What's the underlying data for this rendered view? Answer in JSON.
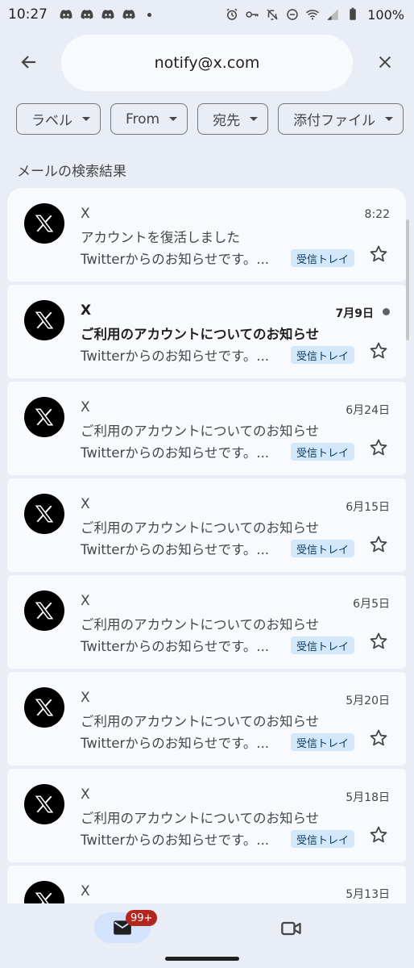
{
  "status_bar": {
    "time": "10:27",
    "battery": "100%",
    "left_icons": [
      "discord-icon",
      "discord-icon",
      "discord-icon",
      "discord-icon"
    ],
    "right_icons": [
      "alarm-icon",
      "key-icon",
      "bell-off-icon",
      "do-not-disturb-icon",
      "wifi-icon",
      "signal-icon",
      "battery-icon"
    ]
  },
  "search": {
    "query": "notify@x.com"
  },
  "filters": [
    {
      "label": "ラベル"
    },
    {
      "label": "From"
    },
    {
      "label": "宛先"
    },
    {
      "label": "添付ファイル"
    }
  ],
  "section_title": "メールの検索結果",
  "emails": [
    {
      "sender": "X",
      "date": "8:22",
      "subject": "アカウントを復活しました",
      "snippet": "Twitterからのお知らせです。...",
      "label": "受信トレイ",
      "unread": false
    },
    {
      "sender": "X",
      "date": "7月9日",
      "subject": "ご利用のアカウントについてのお知らせ",
      "snippet": "Twitterからのお知らせです。...",
      "label": "受信トレイ",
      "unread": true
    },
    {
      "sender": "X",
      "date": "6月24日",
      "subject": "ご利用のアカウントについてのお知らせ",
      "snippet": "Twitterからのお知らせです。...",
      "label": "受信トレイ",
      "unread": false
    },
    {
      "sender": "X",
      "date": "6月15日",
      "subject": "ご利用のアカウントについてのお知らせ",
      "snippet": "Twitterからのお知らせです。...",
      "label": "受信トレイ",
      "unread": false
    },
    {
      "sender": "X",
      "date": "6月5日",
      "subject": "ご利用のアカウントについてのお知らせ",
      "snippet": "Twitterからのお知らせです。...",
      "label": "受信トレイ",
      "unread": false
    },
    {
      "sender": "X",
      "date": "5月20日",
      "subject": "ご利用のアカウントについてのお知らせ",
      "snippet": "Twitterからのお知らせです。...",
      "label": "受信トレイ",
      "unread": false
    },
    {
      "sender": "X",
      "date": "5月18日",
      "subject": "ご利用のアカウントについてのお知らせ",
      "snippet": "Twitterからのお知らせです。...",
      "label": "受信トレイ",
      "unread": false
    },
    {
      "sender": "X",
      "date": "5月13日",
      "subject": "",
      "snippet": "",
      "label": "",
      "unread": false
    }
  ],
  "bottom_nav": {
    "mail_badge": "99+"
  },
  "colors": {
    "background": "#e9edf5",
    "card": "#f8fafd",
    "label_badge": "#d3e8fb",
    "nav_active": "#d3e3fd",
    "badge": "#b3261e"
  }
}
